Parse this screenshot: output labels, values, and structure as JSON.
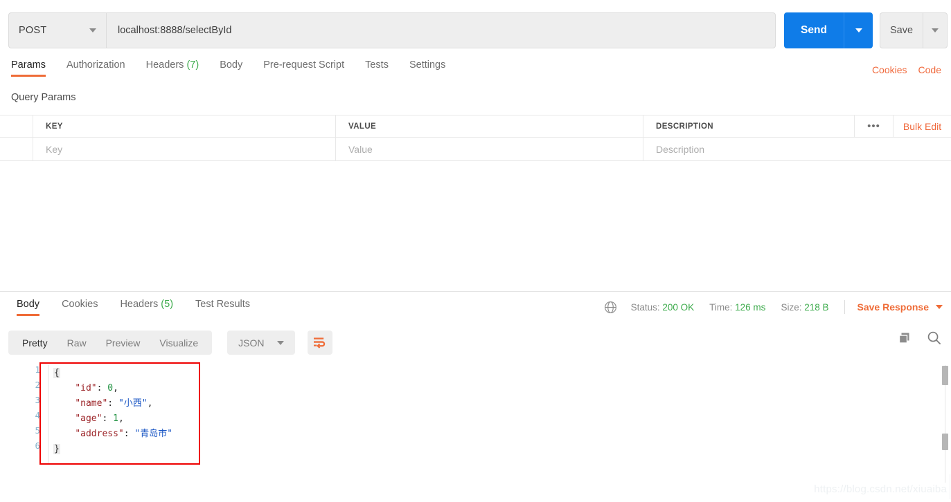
{
  "request": {
    "method": "POST",
    "url": "localhost:8888/selectById",
    "send_label": "Send",
    "save_label": "Save",
    "tabs": [
      {
        "label": "Params",
        "badge": "",
        "active": true
      },
      {
        "label": "Authorization",
        "badge": "",
        "active": false
      },
      {
        "label": "Headers",
        "badge": "(7)",
        "active": false
      },
      {
        "label": "Body",
        "badge": "",
        "active": false
      },
      {
        "label": "Pre-request Script",
        "badge": "",
        "active": false
      },
      {
        "label": "Tests",
        "badge": "",
        "active": false
      },
      {
        "label": "Settings",
        "badge": "",
        "active": false
      }
    ],
    "links": [
      {
        "label": "Cookies"
      },
      {
        "label": "Code"
      }
    ]
  },
  "query_params": {
    "section_title": "Query Params",
    "columns": [
      "KEY",
      "VALUE",
      "DESCRIPTION"
    ],
    "row_placeholders": [
      "Key",
      "Value",
      "Description"
    ],
    "dots_label": "•••",
    "bulk_edit_label": "Bulk Edit"
  },
  "response": {
    "tabs": [
      {
        "label": "Body",
        "badge": "",
        "active": true
      },
      {
        "label": "Cookies",
        "badge": "",
        "active": false
      },
      {
        "label": "Headers",
        "badge": "(5)",
        "active": false
      },
      {
        "label": "Test Results",
        "badge": "",
        "active": false
      }
    ],
    "meta": {
      "status_label": "Status:",
      "status_value": "200 OK",
      "time_label": "Time:",
      "time_value": "126 ms",
      "size_label": "Size:",
      "size_value": "218 B",
      "save_response_label": "Save Response"
    },
    "view_modes": [
      {
        "label": "Pretty",
        "active": true
      },
      {
        "label": "Raw",
        "active": false
      },
      {
        "label": "Preview",
        "active": false
      },
      {
        "label": "Visualize",
        "active": false
      }
    ],
    "format": "JSON",
    "body": {
      "line_numbers": [
        "1",
        "2",
        "3",
        "4",
        "5",
        "6"
      ],
      "open_brace": "{",
      "close_brace": "}",
      "entries": [
        {
          "key": "\"id\"",
          "sep": ": ",
          "value": "0",
          "type": "number",
          "comma": ","
        },
        {
          "key": "\"name\"",
          "sep": ": ",
          "value": "\"小西\"",
          "type": "string",
          "comma": ","
        },
        {
          "key": "\"age\"",
          "sep": ": ",
          "value": "1",
          "type": "number",
          "comma": ","
        },
        {
          "key": "\"address\"",
          "sep": ": ",
          "value": "\"青岛市\"",
          "type": "string",
          "comma": ""
        }
      ]
    }
  },
  "watermark": "https://blog.csdn.net/xiuaiba",
  "colors": {
    "accent_orange": "#ef6c38",
    "send_blue": "#0f7ce8",
    "success_green": "#3dab4c",
    "json_key": "#9b2226",
    "json_string": "#1a56c4",
    "json_number": "#1a8f3c",
    "highlight_box": "#ee0000"
  }
}
